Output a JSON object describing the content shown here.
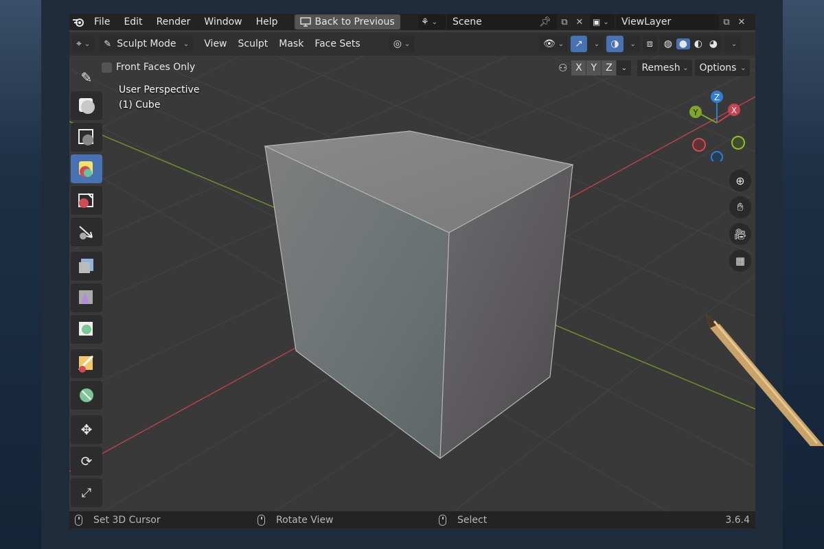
{
  "topbar": {
    "menus": [
      "File",
      "Edit",
      "Render",
      "Window",
      "Help"
    ],
    "back_label": "Back to Previous",
    "scene": "Scene",
    "view_layer": "ViewLayer"
  },
  "header": {
    "mode": "Sculpt Mode",
    "menus": [
      "View",
      "Sculpt",
      "Mask",
      "Face Sets"
    ],
    "remesh": "Remesh",
    "options": "Options"
  },
  "subheader": {
    "front_faces_label": "Front Faces Only",
    "axes": [
      "X",
      "Y",
      "Z"
    ]
  },
  "viewport": {
    "perspective": "User Perspective",
    "object": "(1) Cube",
    "gizmo": {
      "z": "Z",
      "y": "Y",
      "x": "X"
    }
  },
  "tools": [
    "draw-brush-icon",
    "clay-strips-icon",
    "smooth-icon",
    "layer-icon",
    "snake-hook-icon",
    "grab-icon",
    "mask-icon",
    "box-mask-icon",
    "lasso-mask-icon",
    "face-set-icon",
    "mesh-filter-icon",
    "move-icon",
    "rotate-icon",
    "scale-icon"
  ],
  "statusbar": {
    "left": "Set 3D Cursor",
    "middle": "Rotate View",
    "right": "Select",
    "version": "3.6.4"
  },
  "colors": {
    "accent": "#4772b3",
    "axis_x": "#c8434f",
    "axis_y": "#7fa62b",
    "axis_z": "#2f7fd6"
  }
}
